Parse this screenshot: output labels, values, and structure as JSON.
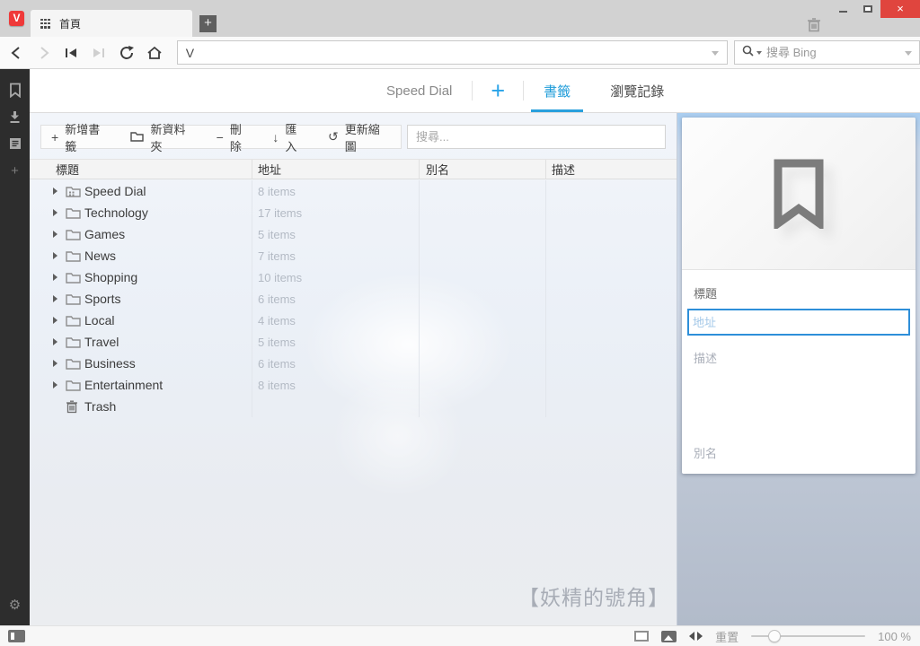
{
  "titlebar": {
    "tab_title": "首頁"
  },
  "navbar": {
    "address_logo": "V",
    "address_value": "",
    "search_placeholder": "搜尋 Bing"
  },
  "page_tabs": {
    "speed_dial": "Speed Dial",
    "add": "+",
    "bookmarks": "書籤",
    "history": "瀏覽記錄"
  },
  "toolbar": {
    "add_glyph": "+",
    "add_bookmark": "新增書籤",
    "new_folder": "新資料夾",
    "delete_glyph": "−",
    "delete": "刪除",
    "import_glyph": "↓",
    "import": "匯入",
    "update_glyph": "↺",
    "update_thumbnails": "更新縮圖",
    "search_placeholder": "搜尋..."
  },
  "table": {
    "headers": {
      "title": "標題",
      "address": "地址",
      "nickname": "別名",
      "description": "描述"
    },
    "rows": [
      {
        "name": "Speed Dial",
        "items": "8 items"
      },
      {
        "name": "Technology",
        "items": "17 items"
      },
      {
        "name": "Games",
        "items": "5 items"
      },
      {
        "name": "News",
        "items": "7 items"
      },
      {
        "name": "Shopping",
        "items": "10 items"
      },
      {
        "name": "Sports",
        "items": "6 items"
      },
      {
        "name": "Local",
        "items": "4 items"
      },
      {
        "name": "Travel",
        "items": "5 items"
      },
      {
        "name": "Business",
        "items": "6 items"
      },
      {
        "name": "Entertainment",
        "items": "8 items"
      },
      {
        "name": "Trash",
        "items": ""
      }
    ]
  },
  "editor": {
    "title_label": "標題",
    "address_placeholder": "地址",
    "description_placeholder": "描述",
    "nickname_placeholder": "別名"
  },
  "content_watermark": "【妖精的號角】",
  "statusbar": {
    "reset_label": "重置",
    "zoom_value": "100 %"
  },
  "window_controls": {
    "close_glyph": "×"
  },
  "sidebar_plus_glyph": "+",
  "gear_glyph": "⚙",
  "colors": {
    "vivaldi_red": "#ef3939",
    "close_red": "#e0453e",
    "accent_blue": "#1f9cd9",
    "focus_border": "#2e8fd9",
    "sidebar_dark": "#2d2d2d"
  }
}
